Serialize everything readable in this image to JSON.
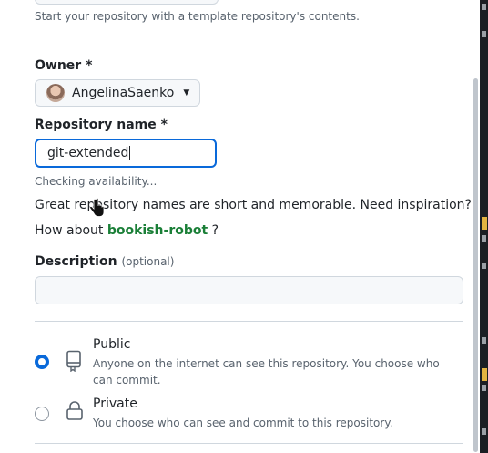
{
  "template_hint": "Start your repository with a template repository's contents.",
  "owner": {
    "label": "Owner *",
    "name": "AngelinaSaenko"
  },
  "repo": {
    "label": "Repository name *",
    "value": "git-extended",
    "status": "Checking availability...",
    "tip": "Great repository names are short and memorable. Need inspiration?",
    "how_about": "How about",
    "suggestion": "bookish-robot",
    "question_mark": "?"
  },
  "description": {
    "label": "Description",
    "optional": "(optional)",
    "value": ""
  },
  "visibility": {
    "public_title": "Public",
    "public_desc": "Anyone on the internet can see this repository. You choose who can commit.",
    "private_title": "Private",
    "private_desc": "You choose who can see and commit to this repository."
  },
  "icons": [
    "caret-down-icon",
    "repo-icon",
    "lock-icon",
    "pointer-hand-icon"
  ],
  "colors": {
    "accent": "#0969da",
    "suggestion": "#1a7f37",
    "muted": "#59636e"
  }
}
